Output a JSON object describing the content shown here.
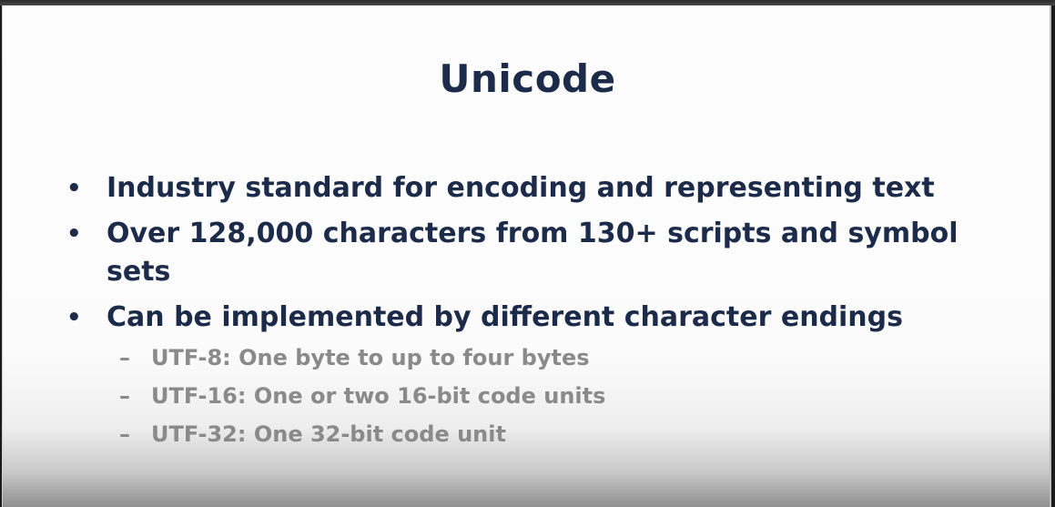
{
  "slide": {
    "title": "Unicode",
    "bullets": [
      "Industry standard for encoding and representing text",
      "Over 128,000 characters from 130+ scripts and symbol sets",
      "Can be implemented by different character endings"
    ],
    "sub_bullets": [
      "UTF-8: One byte to up to four bytes",
      "UTF-16: One or two 16-bit code units",
      "UTF-32: One 32-bit code unit"
    ]
  },
  "colors": {
    "title": "#1c2b4a",
    "bullet_text": "#1c2b4a",
    "sub_bullet_text": "#8a8a8a",
    "background": "#fdfdfd"
  }
}
